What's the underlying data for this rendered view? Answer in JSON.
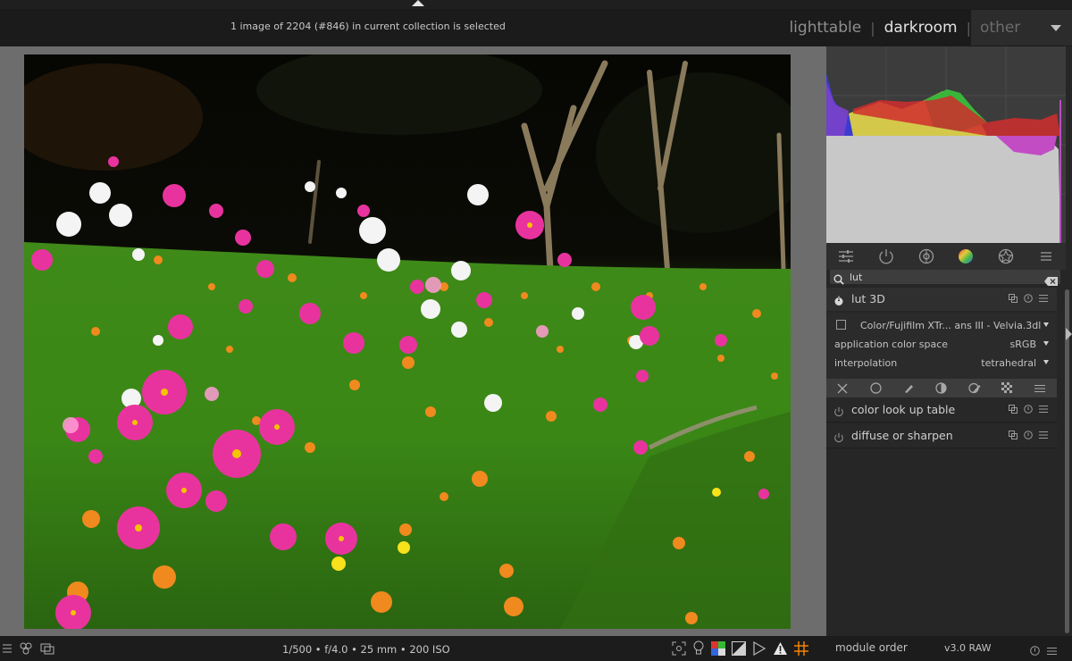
{
  "header": {
    "status": "1 image of 2204 (#846) in current collection is selected",
    "views": [
      "lighttable",
      "darkroom",
      "other"
    ],
    "active_view": "darkroom",
    "separator": "|"
  },
  "image": {
    "subject": "field of pink, white and orange cosmos flowers with trees in dark background"
  },
  "search": {
    "value": "lut"
  },
  "modules": {
    "lut3d": {
      "name": "lut 3D",
      "file": "Color/Fujifilm XTr... ans III - Velvia.3dl",
      "params": [
        {
          "label": "application color space",
          "value": "sRGB"
        },
        {
          "label": "interpolation",
          "value": "tetrahedral"
        }
      ]
    },
    "others": [
      {
        "name": "color look up table"
      },
      {
        "name": "diffuse or sharpen"
      }
    ]
  },
  "bottom": {
    "exif": "1/500 • f/4.0 • 25 mm • 200 ISO",
    "module_order_label": "module order",
    "module_order_value": "v3.0 RAW"
  },
  "colors": {
    "accent": "#ff8a00",
    "panel": "#262626",
    "background": "#6d6d6d"
  }
}
